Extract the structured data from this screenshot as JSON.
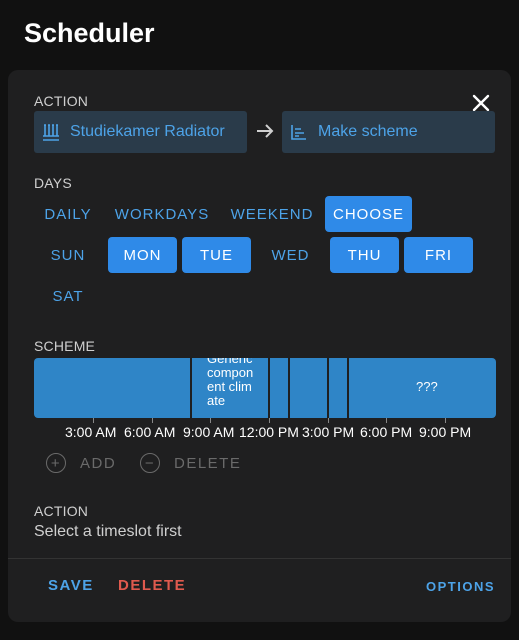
{
  "page": {
    "title": "Scheduler"
  },
  "action": {
    "label": "ACTION",
    "entity": "Studiekamer Radiator",
    "service": "Make scheme"
  },
  "days": {
    "label": "DAYS",
    "modes": [
      "DAILY",
      "WORKDAYS",
      "WEEKEND",
      "CHOOSE"
    ],
    "selected_mode": "CHOOSE",
    "weekdays": [
      "SUN",
      "MON",
      "TUE",
      "WED",
      "THU",
      "FRI",
      "SAT"
    ],
    "selected_days": [
      "MON",
      "TUE",
      "THU",
      "FRI"
    ]
  },
  "scheme": {
    "label": "SCHEME",
    "segment_generic_text": "Generic component climate",
    "segment_unknown_text": "???",
    "ticks": [
      "3:00 AM",
      "6:00 AM",
      "9:00 AM",
      "12:00 PM",
      "3:00 PM",
      "6:00 PM",
      "9:00 PM"
    ],
    "add_label": "ADD",
    "delete_label": "DELETE"
  },
  "slot_action": {
    "label": "ACTION",
    "placeholder": "Select a timeslot first"
  },
  "footer": {
    "save_label": "SAVE",
    "delete_label": "DELETE",
    "options_label": "OPTIONS"
  },
  "colors": {
    "accent": "#4da3e8",
    "selected_bg": "#2f8ae8",
    "timeline": "#2f85c7",
    "danger": "#e05a4e"
  }
}
